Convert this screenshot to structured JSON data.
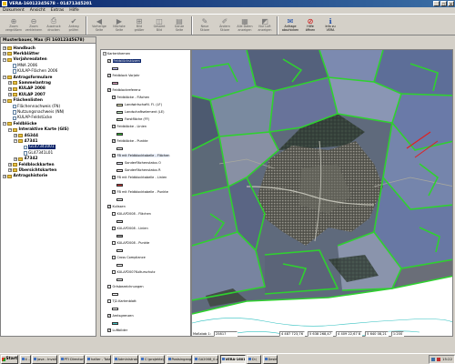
{
  "window": {
    "title": "VERA-16012345678 - 01471345201"
  },
  "menu": [
    "Dokument",
    "Ansicht",
    "Extras",
    "Hilfe"
  ],
  "toolbar": [
    {
      "label": "Zoom\nvergrößern",
      "icon": "zoom-in-icon",
      "active": false
    },
    {
      "label": "Zoom\nverkleinern",
      "icon": "zoom-out-icon",
      "active": false
    },
    {
      "label": "Ausdruck\ndrucken",
      "icon": "printer-icon",
      "active": false
    },
    {
      "label": "Antrag\nprüfen",
      "icon": "check-icon",
      "active": false
    },
    {
      "label": "Vorherige\nSeite",
      "icon": "arrow-left-icon",
      "active": false
    },
    {
      "label": "Nächste\nSeite",
      "icon": "arrow-right-icon",
      "active": false
    },
    {
      "label": "Bild\ngrößer",
      "icon": "zoom-plus-icon",
      "active": false
    },
    {
      "label": "Gesamt\nBild",
      "icon": "fullview-icon",
      "active": false
    },
    {
      "label": "Ganze\nSeite",
      "icon": "page-icon",
      "active": false
    },
    {
      "label": "Neue\nSkizze",
      "icon": "new-sketch-icon",
      "active": false
    },
    {
      "label": "Ändern\nSkizze",
      "icon": "edit-sketch-icon",
      "active": false
    },
    {
      "label": "Alle Daten\nanzeigen",
      "icon": "show-all-icon",
      "active": false
    },
    {
      "label": "Nur Luft\nanzeigen",
      "icon": "aerial-icon",
      "active": false
    },
    {
      "label": "Anfrage\nabschicken",
      "icon": "send-icon",
      "active": true
    },
    {
      "label": "Hilfe\nöffnen",
      "icon": "help-icon",
      "active": true,
      "red": true
    },
    {
      "label": "Info zu\nVERA",
      "icon": "info-icon",
      "active": true
    }
  ],
  "left_panel": {
    "header": "Musterbauer, Max  (Fl 16012345678)",
    "items": [
      {
        "label": "Handbuch",
        "level": 0,
        "exp": "+",
        "bold": true
      },
      {
        "label": "Merkblätter",
        "level": 0,
        "exp": "+",
        "bold": true
      },
      {
        "label": "Vorjahresdaten",
        "level": 0,
        "exp": "−",
        "bold": true
      },
      {
        "label": "MNA 2006",
        "level": 1,
        "exp": "",
        "bold": false
      },
      {
        "label": "KULAP-Flächen 2006",
        "level": 1,
        "exp": "",
        "bold": false
      },
      {
        "label": "Antragsformulare",
        "level": 0,
        "exp": "−",
        "bold": true
      },
      {
        "label": "Sammelantrag",
        "level": 1,
        "exp": "+",
        "bold": true
      },
      {
        "label": "KULAP 2008",
        "level": 1,
        "exp": "+",
        "bold": true
      },
      {
        "label": "KULAP 2007",
        "level": 1,
        "exp": "+",
        "bold": true
      },
      {
        "label": "Flächenlisten",
        "level": 0,
        "exp": "−",
        "bold": true
      },
      {
        "label": "Flächennachweis (FN)",
        "level": 1,
        "exp": "",
        "bold": false
      },
      {
        "label": "Nutzungsnachweis (NN)",
        "level": 1,
        "exp": "",
        "bold": false
      },
      {
        "label": "KULAP-Feldstücke",
        "level": 1,
        "exp": "",
        "bold": false
      },
      {
        "label": "Feldblöcke",
        "level": 0,
        "exp": "−",
        "bold": true
      },
      {
        "label": "Interaktive Karte (GIS)",
        "level": 1,
        "exp": "−",
        "bold": true
      },
      {
        "label": "4G344",
        "level": 2,
        "exp": "+",
        "bold": true
      },
      {
        "label": "47341",
        "level": 2,
        "exp": "−",
        "bold": true
      },
      {
        "label": "GL47341001",
        "level": 3,
        "exp": "",
        "bold": false,
        "selected": true
      },
      {
        "label": "GL47341L01",
        "level": 3,
        "exp": "",
        "bold": false
      },
      {
        "label": "47342",
        "level": 2,
        "exp": "+",
        "bold": true
      },
      {
        "label": "Feldblockkarten",
        "level": 1,
        "exp": "+",
        "bold": true
      },
      {
        "label": "Übersichtskarten",
        "level": 1,
        "exp": "+",
        "bold": true
      },
      {
        "label": "Antragshistorie",
        "level": 0,
        "exp": "+",
        "bold": true
      }
    ]
  },
  "layer_panel": {
    "items": [
      {
        "label": "Kartenthemen",
        "indent": 0,
        "cb": "",
        "swatch": ""
      },
      {
        "label": "Feldstückskizzen",
        "indent": 1,
        "cb": "✓",
        "swatch": "",
        "selected": true
      },
      {
        "label": "",
        "indent": 2,
        "cb": "",
        "swatch": "#c8c8ff"
      },
      {
        "label": "Feldblock Vorjahr",
        "indent": 1,
        "cb": "✓",
        "swatch": ""
      },
      {
        "label": "",
        "indent": 2,
        "cb": "",
        "swatch": "#e0a0c0"
      },
      {
        "label": "Feldblockreferenz",
        "indent": 1,
        "cb": "✓",
        "swatch": ""
      },
      {
        "label": "Feldblöcke - Flächen",
        "indent": 2,
        "cb": "✓",
        "swatch": ""
      },
      {
        "label": "Landwirtschaftl. Fl. (LF)",
        "indent": 3,
        "cb": "",
        "swatch": "#f4f4c0"
      },
      {
        "label": "Landschaftselement (LE)",
        "indent": 3,
        "cb": "",
        "swatch": "#c0e8c0"
      },
      {
        "label": "Forstfläche (FF)",
        "indent": 3,
        "cb": "",
        "swatch": "#d8ecd0"
      },
      {
        "label": "Feldblöcke - Linien",
        "indent": 2,
        "cb": "✓",
        "swatch": ""
      },
      {
        "label": "",
        "indent": 3,
        "cb": "",
        "swatch": "#30c030"
      },
      {
        "label": "Feldblöcke - Punkte",
        "indent": 2,
        "cb": "✓",
        "swatch": ""
      },
      {
        "label": "",
        "indent": 3,
        "cb": "",
        "swatch": "#ffffff"
      },
      {
        "label": "FB mit Feldblocktabelle - Flächen",
        "indent": 2,
        "cb": "✓",
        "swatch": "",
        "highlight": true
      },
      {
        "label": "Sonderflächenstatus O",
        "indent": 3,
        "cb": "",
        "swatch": "#e8e8f8"
      },
      {
        "label": "Sonderflächenstatus R",
        "indent": 3,
        "cb": "",
        "swatch": "#f8e8e8"
      },
      {
        "label": "FB mit Feldblocktabelle - Linien",
        "indent": 2,
        "cb": "✓",
        "swatch": ""
      },
      {
        "label": "",
        "indent": 3,
        "cb": "",
        "swatch": "#d03030"
      },
      {
        "label": "FB mit Feldblocktabelle - Punkte",
        "indent": 2,
        "cb": "✓",
        "swatch": ""
      },
      {
        "label": "",
        "indent": 3,
        "cb": "",
        "swatch": "#ffffff"
      },
      {
        "label": "Kulissen",
        "indent": 1,
        "cb": "✓",
        "swatch": ""
      },
      {
        "label": "KULAP2008 - Flächen",
        "indent": 2,
        "cb": "",
        "swatch": ""
      },
      {
        "label": "",
        "indent": 3,
        "cb": "",
        "swatch": "#e0e0e0"
      },
      {
        "label": "KULAP2008 - Linien",
        "indent": 2,
        "cb": "",
        "swatch": ""
      },
      {
        "label": "",
        "indent": 3,
        "cb": "",
        "swatch": "#a0a0a0"
      },
      {
        "label": "KULAP2008 - Punkte",
        "indent": 2,
        "cb": "",
        "swatch": ""
      },
      {
        "label": "",
        "indent": 3,
        "cb": "",
        "swatch": "#ffffff"
      },
      {
        "label": "Cross Compliance",
        "indent": 2,
        "cb": "",
        "swatch": ""
      },
      {
        "label": "",
        "indent": 3,
        "cb": "",
        "swatch": "#ffffff"
      },
      {
        "label": "KULAP2007Kulturschutz",
        "indent": 2,
        "cb": "",
        "swatch": ""
      },
      {
        "label": "",
        "indent": 3,
        "cb": "",
        "swatch": "#ffffff"
      },
      {
        "label": "Ortsbezeichnungen",
        "indent": 1,
        "cb": "",
        "swatch": ""
      },
      {
        "label": "",
        "indent": 2,
        "cb": "",
        "swatch": "#ffffff"
      },
      {
        "label": "TJ2-Kartenblatt",
        "indent": 1,
        "cb": "",
        "swatch": ""
      },
      {
        "label": "",
        "indent": 2,
        "cb": "",
        "swatch": "#ffffff"
      },
      {
        "label": "Amtsgrenzen",
        "indent": 1,
        "cb": "✓",
        "swatch": ""
      },
      {
        "label": "",
        "indent": 2,
        "cb": "",
        "swatch": "#40c0c0"
      },
      {
        "label": "Luftbilder",
        "indent": 1,
        "cb": "✓",
        "swatch": ""
      }
    ]
  },
  "status": {
    "scale_label": "Maßstab 1:",
    "scale_value": "25817",
    "x_coord": "4 487 723,76",
    "y_coord": "5 638 268,47",
    "extent": "4 409 22,67 8",
    "northing": "5 640 08,21",
    "zoom": "1:200"
  },
  "taskbar": {
    "start": "Start",
    "tasks": [
      "4 ...",
      "Java - Invalid...",
      "PTI Directory...",
      "halter - Total...",
      "Administrator...",
      "C:\\projekte\\v...",
      "Postsingang...",
      "GA2008_0-cr...",
      "VERA-16012...",
      "D:\\",
      "Desktop"
    ],
    "active_task": 8,
    "time": "15:22"
  }
}
